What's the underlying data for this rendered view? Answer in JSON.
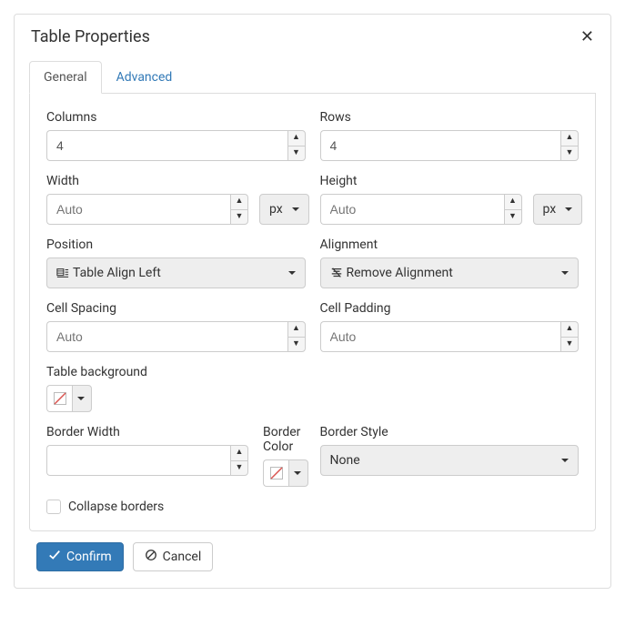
{
  "dialog": {
    "title": "Table Properties"
  },
  "tabs": {
    "general": "General",
    "advanced": "Advanced"
  },
  "labels": {
    "columns": "Columns",
    "rows": "Rows",
    "width": "Width",
    "height": "Height",
    "position": "Position",
    "alignment": "Alignment",
    "cellSpacing": "Cell Spacing",
    "cellPadding": "Cell Padding",
    "tableBackground": "Table background",
    "borderWidth": "Border Width",
    "borderColor": "Border Color",
    "borderStyle": "Border Style",
    "collapseBorders": "Collapse borders"
  },
  "values": {
    "columns": "4",
    "rows": "4",
    "width": "",
    "height": "",
    "widthPlaceholder": "Auto",
    "heightPlaceholder": "Auto",
    "widthUnit": "px",
    "heightUnit": "px",
    "position": "Table Align Left",
    "alignment": "Remove Alignment",
    "cellSpacing": "",
    "cellPadding": "",
    "cellSpacingPlaceholder": "Auto",
    "cellPaddingPlaceholder": "Auto",
    "borderWidth": "",
    "borderStyle": "None"
  },
  "buttons": {
    "confirm": "Confirm",
    "cancel": "Cancel"
  }
}
